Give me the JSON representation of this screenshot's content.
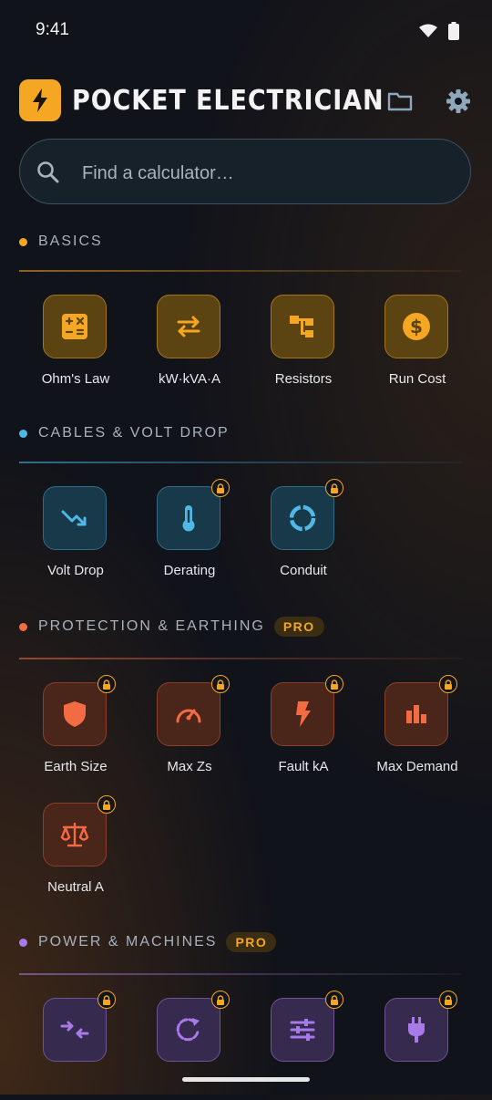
{
  "status": {
    "time": "9:41",
    "icons": [
      "wifi-icon",
      "battery-icon"
    ]
  },
  "header": {
    "title": "POCKET ELECTRICIAN",
    "logo_icon": "lightning-bolt-icon",
    "actions": [
      "folder-icon",
      "gear-icon"
    ]
  },
  "search": {
    "placeholder": "Find a calculator…",
    "value": ""
  },
  "colors": {
    "basics": "#f5a623",
    "cables": "#4fb8e6",
    "protection": "#f26b43",
    "power": "#a779e9",
    "pro_badge": "#f5a623"
  },
  "sections": [
    {
      "title": "BASICS",
      "pro": "",
      "tiles": [
        {
          "label": "Ohm's Law",
          "icon": "calculator-icon",
          "locked": false
        },
        {
          "label": "kW·kVA·A",
          "icon": "swap-arrows-icon",
          "locked": false
        },
        {
          "label": "Resistors",
          "icon": "resistor-tree-icon",
          "locked": false
        },
        {
          "label": "Run Cost",
          "icon": "dollar-coin-icon",
          "locked": false
        }
      ]
    },
    {
      "title": "CABLES & VOLT DROP",
      "pro": "",
      "tiles": [
        {
          "label": "Volt Drop",
          "icon": "trending-down-icon",
          "locked": false
        },
        {
          "label": "Derating",
          "icon": "thermometer-icon",
          "locked": true
        },
        {
          "label": "Conduit",
          "icon": "ring-icon",
          "locked": true
        }
      ]
    },
    {
      "title": "PROTECTION & EARTHING",
      "pro": "PRO",
      "tiles": [
        {
          "label": "Earth Size",
          "icon": "shield-icon",
          "locked": true
        },
        {
          "label": "Max Zs",
          "icon": "gauge-icon",
          "locked": true
        },
        {
          "label": "Fault kA",
          "icon": "flash-icon",
          "locked": true
        },
        {
          "label": "Max Demand",
          "icon": "bar-chart-icon",
          "locked": true
        },
        {
          "label": "Neutral A",
          "icon": "scales-icon",
          "locked": true
        }
      ]
    },
    {
      "title": "POWER & MACHINES",
      "pro": "PRO",
      "tiles": [
        {
          "label": "",
          "icon": "compress-arrows-icon",
          "locked": true
        },
        {
          "label": "",
          "icon": "rotate-icon",
          "locked": true
        },
        {
          "label": "",
          "icon": "sliders-icon",
          "locked": true
        },
        {
          "label": "",
          "icon": "power-plug-icon",
          "locked": true
        }
      ]
    }
  ]
}
